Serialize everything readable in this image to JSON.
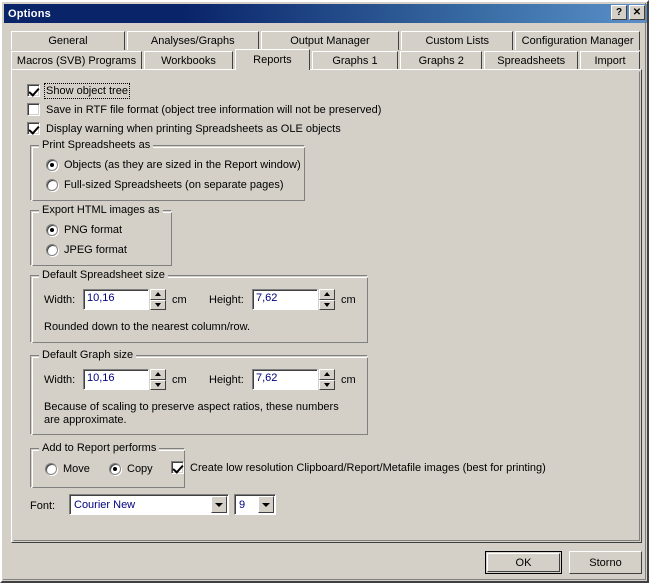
{
  "window": {
    "title": "Options",
    "help_button": "?",
    "close_button": "✕"
  },
  "tabs": {
    "row1": [
      {
        "label": "General",
        "active": false
      },
      {
        "label": "Analyses/Graphs",
        "active": false
      },
      {
        "label": "Output Manager",
        "active": false
      },
      {
        "label": "Custom Lists",
        "active": false
      },
      {
        "label": "Configuration Manager",
        "active": false
      }
    ],
    "row2": [
      {
        "label": "Macros (SVB) Programs",
        "active": false
      },
      {
        "label": "Workbooks",
        "active": false
      },
      {
        "label": "Reports",
        "active": true
      },
      {
        "label": "Graphs 1",
        "active": false
      },
      {
        "label": "Graphs 2",
        "active": false
      },
      {
        "label": "Spreadsheets",
        "active": false
      },
      {
        "label": "Import",
        "active": false
      }
    ]
  },
  "reports": {
    "checkboxes": [
      {
        "label": "Show object tree",
        "checked": true,
        "focused": true
      },
      {
        "label": "Save in RTF file format (object tree information will not be preserved)",
        "checked": false,
        "focused": false
      },
      {
        "label": "Display warning when printing Spreadsheets as OLE objects",
        "checked": true,
        "focused": false
      }
    ],
    "print_spreadsheets": {
      "title": "Print Spreadsheets as",
      "options": [
        {
          "label": "Objects (as they are sized in the Report window)",
          "selected": true
        },
        {
          "label": "Full-sized Spreadsheets (on separate pages)",
          "selected": false
        }
      ]
    },
    "export_html": {
      "title": "Export HTML images as",
      "options": [
        {
          "label": "PNG format",
          "selected": true
        },
        {
          "label": "JPEG format",
          "selected": false
        }
      ]
    },
    "default_spreadsheet_size": {
      "title": "Default Spreadsheet size",
      "width_label": "Width:",
      "width_value": "10,16",
      "width_unit": "cm",
      "height_label": "Height:",
      "height_value": "7,62",
      "height_unit": "cm",
      "note": "Rounded down to the nearest column/row."
    },
    "default_graph_size": {
      "title": "Default Graph size",
      "width_label": "Width:",
      "width_value": "10,16",
      "width_unit": "cm",
      "height_label": "Height:",
      "height_value": "7,62",
      "height_unit": "cm",
      "note": "Because of scaling to preserve aspect ratios, these numbers are approximate."
    },
    "add_to_report": {
      "title": "Add to Report performs",
      "options": [
        {
          "label": "Move",
          "selected": false
        },
        {
          "label": "Copy",
          "selected": true
        }
      ]
    },
    "low_resolution": {
      "label": "Create low resolution Clipboard/Report/Metafile images (best for printing)",
      "checked": true
    },
    "font": {
      "label": "Font:",
      "family_value": "Courier New",
      "size_value": "9"
    }
  },
  "buttons": {
    "ok": "OK",
    "cancel": "Storno"
  },
  "colors": {
    "dialog_face": "#d4d0c8",
    "title_gradient_start": "#0a246a",
    "title_gradient_end": "#5b8fc9",
    "field_text": "#00007f"
  }
}
